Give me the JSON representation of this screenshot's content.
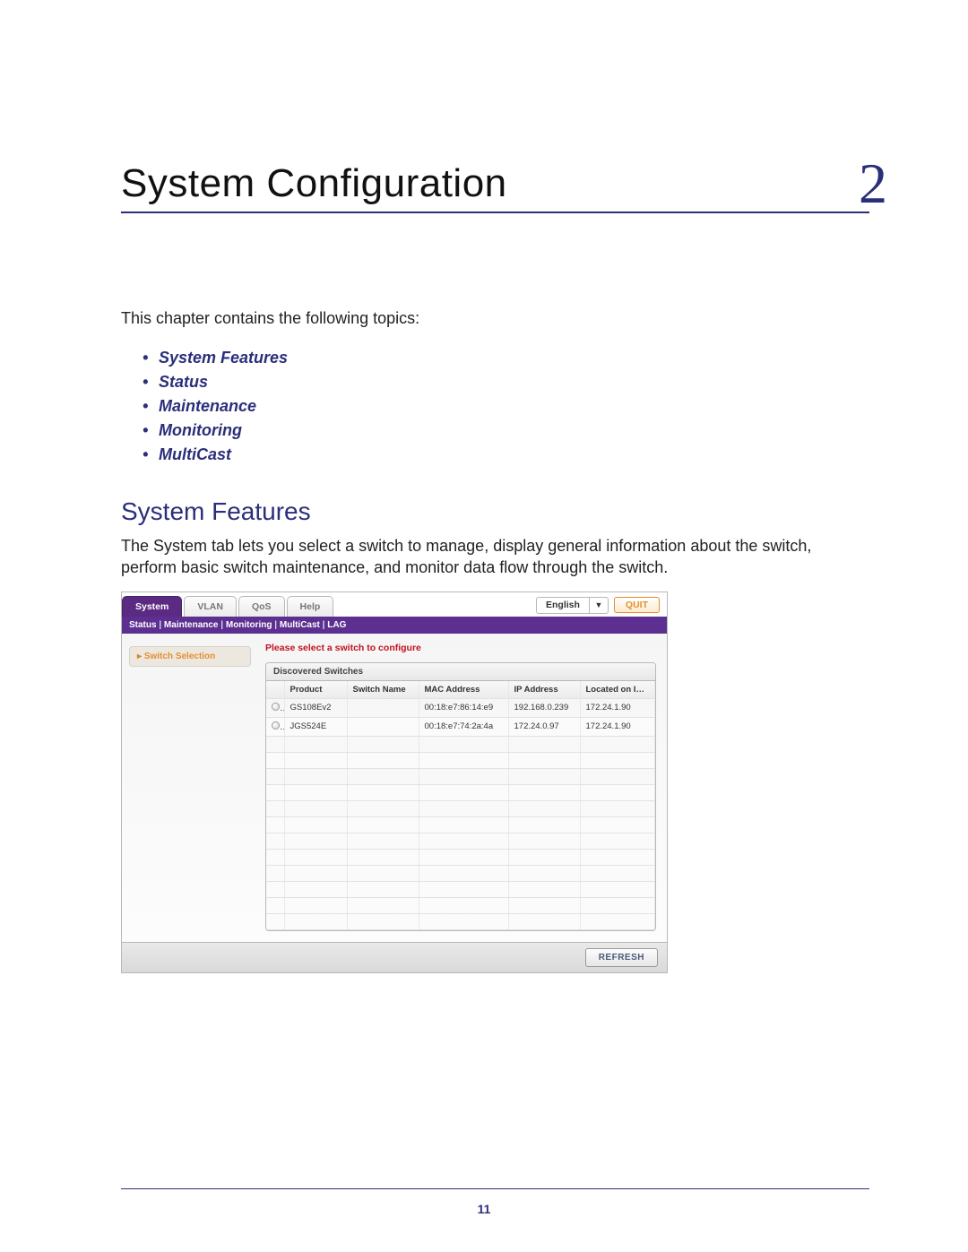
{
  "chapter": {
    "title": "System Configuration",
    "number": "2"
  },
  "intro": "This chapter contains the following topics:",
  "topics": [
    "System Features",
    "Status",
    "Maintenance",
    "Monitoring",
    "MultiCast"
  ],
  "section": {
    "heading": "System Features",
    "body": "The System tab lets you select a switch to manage, display general information about the switch, perform basic switch maintenance, and monitor data flow through the switch."
  },
  "app": {
    "tabs": [
      "System",
      "VLAN",
      "QoS",
      "Help"
    ],
    "active_tab_index": 0,
    "language": "English",
    "quit": "QUIT",
    "subnav": [
      "Status",
      "Maintenance",
      "Monitoring",
      "MultiCast",
      "LAG"
    ],
    "sidebar_item": "Switch Selection",
    "prompt": "Please select a switch to configure",
    "panel_title": "Discovered Switches",
    "columns": [
      "Product",
      "Switch Name",
      "MAC Address",
      "IP Address",
      "Located on IP Network"
    ],
    "rows": [
      {
        "product": "GS108Ev2",
        "switch_name": "",
        "mac": "00:18:e7:86:14:e9",
        "ip": "192.168.0.239",
        "net": "172.24.1.90"
      },
      {
        "product": "JGS524E",
        "switch_name": "",
        "mac": "00:18:e7:74:2a:4a",
        "ip": "172.24.0.97",
        "net": "172.24.1.90"
      }
    ],
    "empty_rows": 12,
    "refresh": "REFRESH"
  },
  "page_number": "11"
}
